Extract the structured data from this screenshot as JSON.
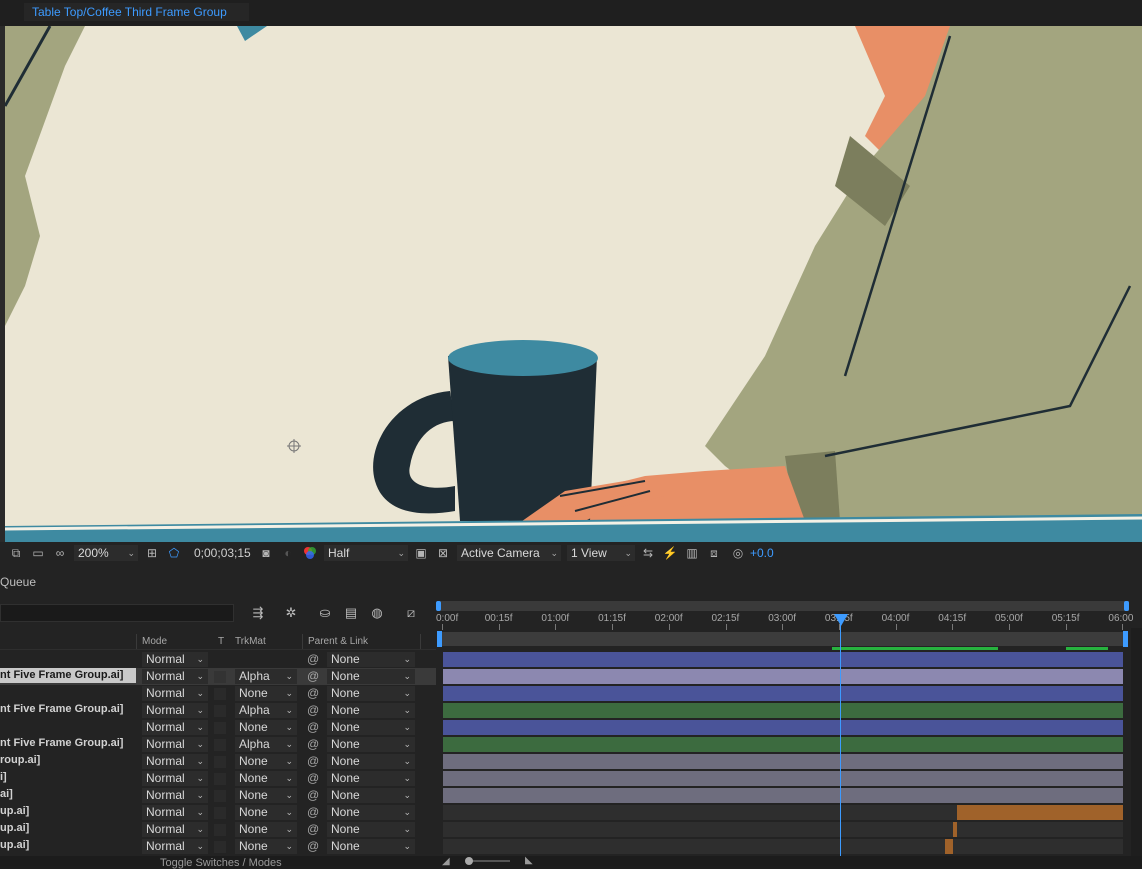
{
  "composition_tab": "Table Top/Coffee Third Frame Group",
  "viewer_toolbar": {
    "magnification": "200%",
    "timecode": "0;00;03;15",
    "resolution": "Half",
    "camera": "Active Camera",
    "views": "1 View",
    "exposure": "+0.0",
    "icons": [
      "always-preview-icon",
      "monitor-icon",
      "vr-glasses-icon",
      "grid-guide-icon",
      "mask-visibility-icon",
      "snapshot-camera-icon",
      "show-snapshot-icon",
      "color-channels-icon",
      "region-of-interest-icon",
      "transparency-grid-icon",
      "reset-exposure-icon",
      "fast-preview-icon",
      "timeline-icon",
      "comp-flowchart-icon",
      "exposure-icon"
    ]
  },
  "panel_label": "Queue",
  "columns": {
    "mode": "Mode",
    "t": "T",
    "trkmat": "TrkMat",
    "parent": "Parent & Link"
  },
  "timeline": {
    "ticks": [
      "0:00f",
      "00:15f",
      "01:00f",
      "01:15f",
      "02:00f",
      "02:15f",
      "03:00f",
      "03:15f",
      "04:00f",
      "04:15f",
      "05:00f",
      "05:15f",
      "06:00"
    ],
    "current_time_index": 7
  },
  "layers": [
    {
      "name": "",
      "mode": "Normal",
      "trkmat": "",
      "parent": "None",
      "bar": "blue"
    },
    {
      "name": "nt Five Frame Group.ai]",
      "mode": "Normal",
      "trkmat": "Alpha",
      "parent": "None",
      "bar": "lavender",
      "selected": true
    },
    {
      "name": "",
      "mode": "Normal",
      "trkmat": "None",
      "parent": "None",
      "bar": "blue"
    },
    {
      "name": "nt Five Frame Group.ai]",
      "mode": "Normal",
      "trkmat": "Alpha",
      "parent": "None",
      "bar": "green"
    },
    {
      "name": "",
      "mode": "Normal",
      "trkmat": "None",
      "parent": "None",
      "bar": "blue"
    },
    {
      "name": "nt Five Frame Group.ai]",
      "mode": "Normal",
      "trkmat": "Alpha",
      "parent": "None",
      "bar": "green"
    },
    {
      "name": "roup.ai]",
      "mode": "Normal",
      "trkmat": "None",
      "parent": "None",
      "bar": "gray"
    },
    {
      "name": "i]",
      "mode": "Normal",
      "trkmat": "None",
      "parent": "None",
      "bar": "gray"
    },
    {
      "name": "ai]",
      "mode": "Normal",
      "trkmat": "None",
      "parent": "None",
      "bar": "gray"
    },
    {
      "name": "up.ai]",
      "mode": "Normal",
      "trkmat": "None",
      "parent": "None",
      "bar": "orange-long"
    },
    {
      "name": "up.ai]",
      "mode": "Normal",
      "trkmat": "None",
      "parent": "None",
      "bar": "orange-short"
    },
    {
      "name": "up.ai]",
      "mode": "Normal",
      "trkmat": "None",
      "parent": "None",
      "bar": "orange-short2"
    }
  ],
  "bottom": {
    "toggle_label": "Toggle Switches / Modes"
  },
  "colors": {
    "accent": "#3d9bff",
    "bar_blue": "#4a5499",
    "bar_lavender": "#8c88b0",
    "bar_green": "#3c6b3f",
    "bar_gray": "#6e6d7e",
    "bar_orange": "#a0622a",
    "canvas_cream": "#ebe6d4",
    "sweater_green": "#a3a57f",
    "skin": "#e88f66",
    "mug_dark": "#1f2d35",
    "mug_teal": "#3e8aa1"
  }
}
